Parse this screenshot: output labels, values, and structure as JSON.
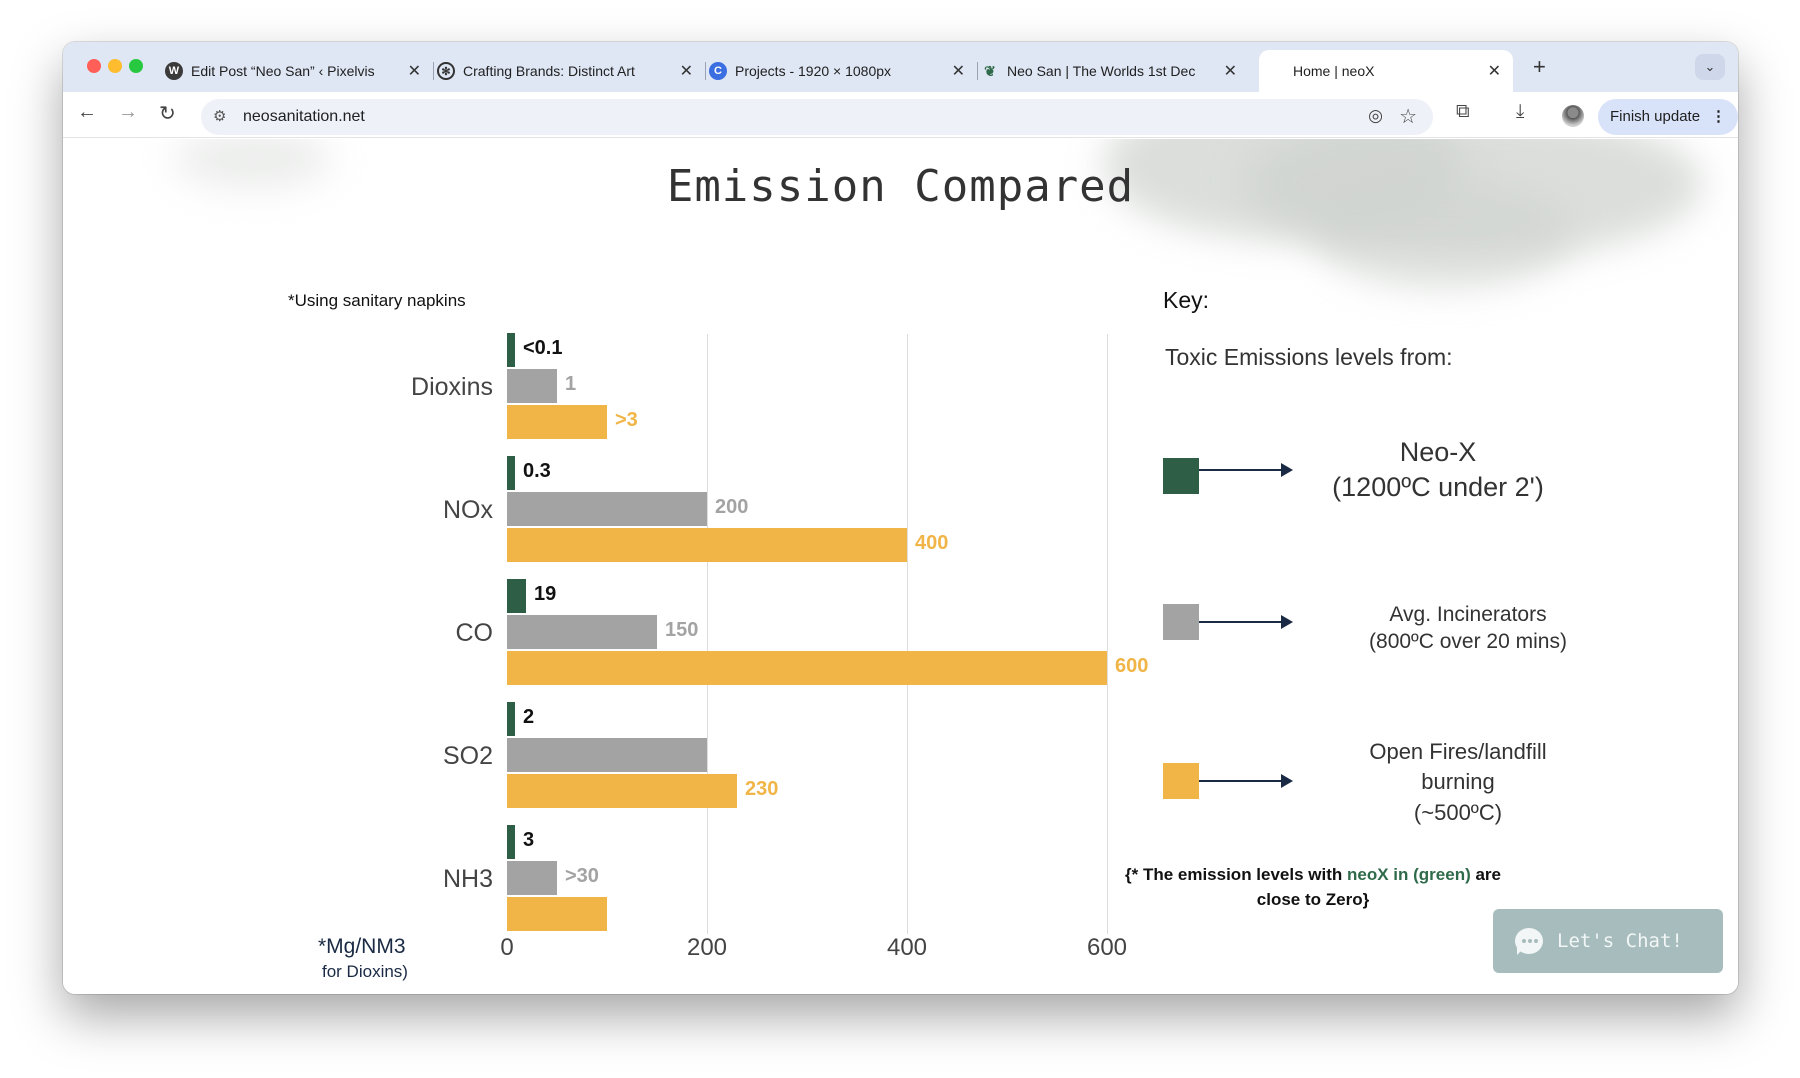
{
  "browser": {
    "tabs": [
      {
        "title": "Edit Post “Neo San” ‹ Pixelvis",
        "icon": "wordpress-icon",
        "active": false
      },
      {
        "title": "Crafting Brands: Distinct Art",
        "icon": "openai-icon",
        "active": false
      },
      {
        "title": "Projects - 1920 × 1080px",
        "icon": "canva-icon",
        "active": false
      },
      {
        "title": "Neo San | The Worlds 1st Dec",
        "icon": "leaf-icon",
        "active": false
      },
      {
        "title": "Home | neoX",
        "icon": "",
        "active": true
      }
    ],
    "close_glyph": "✕",
    "new_tab_glyph": "+",
    "tab_menu_glyph": "⌄",
    "url": "neosanitation.net",
    "finish_update": "Finish update",
    "menu_glyph": "⋮"
  },
  "page": {
    "title": "Emission Compared",
    "note": "*Using sanitary napkins",
    "unit_label": "*Mg/NM3",
    "unit_label_cut": "for Dioxins)",
    "key": {
      "title": "Key:",
      "subtitle": "Toxic Emissions levels from:",
      "items": [
        {
          "line1": "Neo-X",
          "line2": "(1200ºC under 2')",
          "line3": "",
          "color": "#2f5e46"
        },
        {
          "line1": "Avg. Incinerators",
          "line2": "(800ºC over 20 mins)",
          "line3": "",
          "color": "#a3a3a3"
        },
        {
          "line1": "Open Fires/landfill",
          "line2": "burning",
          "line3": "(~500ºC)",
          "color": "#f0b546"
        }
      ]
    },
    "footnote": {
      "part1": "{* The emission levels with ",
      "highlight": "neoX in (green)",
      "part2": " are close to Zero}"
    },
    "chat_label": "Let's Chat!"
  },
  "chart_data": {
    "type": "bar",
    "orientation": "horizontal",
    "categories": [
      "Dioxins",
      "NOx",
      "CO",
      "SO2",
      "NH3"
    ],
    "series": [
      {
        "name": "Neo-X",
        "color": "#2f5e46",
        "values": [
          0.1,
          0.3,
          19,
          2,
          3
        ],
        "labels": [
          "<0.1",
          "0.3",
          "19",
          "2",
          "3"
        ],
        "label_color": "#111111"
      },
      {
        "name": "Avg. Incinerators",
        "color": "#a3a3a3",
        "values": [
          1,
          200,
          150,
          200,
          30
        ],
        "labels": [
          "1",
          "200",
          "150",
          "",
          ">30"
        ],
        "label_color": "#a3a3a3"
      },
      {
        "name": "Open Fires/landfill burning",
        "color": "#f0b546",
        "values": [
          3,
          400,
          600,
          230,
          100
        ],
        "labels": [
          ">3",
          "400",
          "600",
          "230",
          ""
        ],
        "label_color": "#f0b546"
      }
    ],
    "xticks": [
      "0",
      "200",
      "400",
      "600"
    ],
    "xlim": [
      0,
      600
    ],
    "grid": true,
    "legend": "right"
  }
}
